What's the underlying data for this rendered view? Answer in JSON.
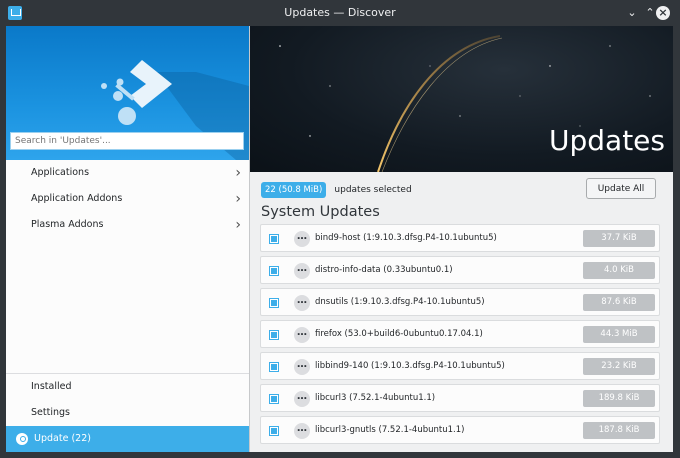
{
  "window": {
    "title": "Updates — Discover"
  },
  "sidebar": {
    "search_placeholder": "Search in 'Updates'...",
    "categories": [
      {
        "label": "Applications"
      },
      {
        "label": "Application Addons"
      },
      {
        "label": "Plasma Addons"
      }
    ],
    "bottom": [
      {
        "label": "Installed"
      },
      {
        "label": "Settings"
      },
      {
        "label": "Update (22)"
      }
    ]
  },
  "banner": {
    "title": "Updates"
  },
  "selection": {
    "badge": "22 (50.8 MiB)",
    "text": "updates selected",
    "update_all_label": "Update All"
  },
  "section": {
    "title": "System Updates"
  },
  "packages": [
    {
      "name": "bind9-host (1:9.10.3.dfsg.P4-10.1ubuntu5)",
      "size": "37.7 KiB"
    },
    {
      "name": "distro-info-data (0.33ubuntu0.1)",
      "size": "4.0 KiB"
    },
    {
      "name": "dnsutils (1:9.10.3.dfsg.P4-10.1ubuntu5)",
      "size": "87.6 KiB"
    },
    {
      "name": "firefox (53.0+build6-0ubuntu0.17.04.1)",
      "size": "44.3 MiB"
    },
    {
      "name": "libbind9-140 (1:9.10.3.dfsg.P4-10.1ubuntu5)",
      "size": "23.2 KiB"
    },
    {
      "name": "libcurl3 (7.52.1-4ubuntu1.1)",
      "size": "189.8 KiB"
    },
    {
      "name": "libcurl3-gnutls (7.52.1-4ubuntu1.1)",
      "size": "187.8 KiB"
    }
  ],
  "colors": {
    "accent": "#3daee9",
    "titlebar": "#31363b"
  }
}
